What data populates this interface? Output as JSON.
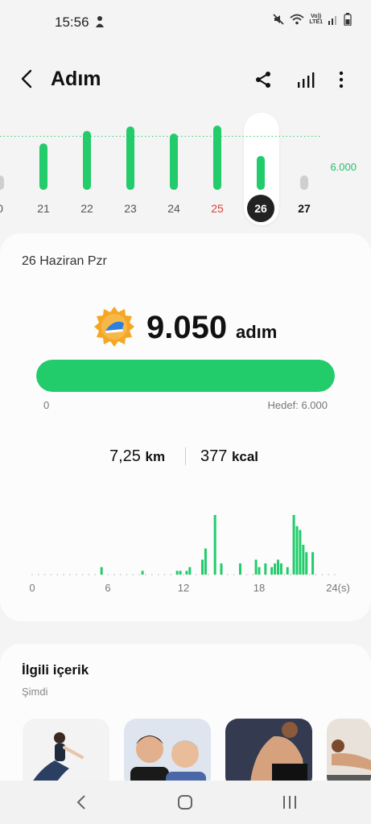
{
  "status": {
    "time": "15:56",
    "lte_top": "Vo))",
    "lte_bottom": "LTE1",
    "icons": [
      "person-icon",
      "mute-icon",
      "wifi-icon",
      "signal-icon",
      "battery-icon"
    ]
  },
  "header": {
    "title": "Adım",
    "icons": [
      "back-arrow-icon",
      "share-icon",
      "bar-chart-icon",
      "more-vertical-icon"
    ]
  },
  "week": {
    "goal": 6000,
    "goal_label": "6.000",
    "days": [
      {
        "label": "0",
        "value": 400,
        "color": "#555555"
      },
      {
        "label": "21",
        "value": 5200,
        "color": "#555555"
      },
      {
        "label": "22",
        "value": 6600,
        "color": "#555555"
      },
      {
        "label": "23",
        "value": 7100,
        "color": "#555555"
      },
      {
        "label": "24",
        "value": 6300,
        "color": "#555555"
      },
      {
        "label": "25",
        "value": 7200,
        "color": "#d94040"
      },
      {
        "label": "26",
        "value": 3800,
        "color": "#ffffff",
        "selected": true
      },
      {
        "label": "27",
        "value": 400,
        "color": "#111111"
      }
    ],
    "bar_color": "#22cc6b",
    "empty_color": "#cfcfcf"
  },
  "summary": {
    "date": "26 Haziran Pzr",
    "steps": "9.050",
    "unit": "adım",
    "progress_fraction": 1.0,
    "min_label": "0",
    "goal_label": "Hedef: 6.000",
    "distance_value": "7,25",
    "distance_unit": "km",
    "calories_value": "377",
    "calories_unit": "kcal"
  },
  "chart_data": {
    "type": "bar",
    "x_tick_labels": [
      "0",
      "6",
      "12",
      "18",
      "24(s)"
    ],
    "x_ticks": [
      0,
      6,
      12,
      18,
      24
    ],
    "xlim": [
      0,
      24
    ],
    "bar_width_hours": 0.25,
    "x": [
      5.5,
      8.75,
      11.25,
      11.5,
      11.75,
      12.0,
      12.25,
      12.5,
      13.25,
      13.5,
      13.75,
      14.0,
      14.5,
      15.0,
      15.5,
      16.0,
      16.5,
      17.0,
      17.5,
      17.75,
      18.0,
      18.5,
      18.75,
      19.0,
      19.25,
      19.5,
      19.75,
      20.25,
      20.75,
      21.0,
      21.25,
      21.5,
      21.75,
      22.25
    ],
    "y": [
      2,
      1,
      0,
      1,
      1,
      0,
      1,
      2,
      0,
      4,
      7,
      0,
      16,
      3,
      0,
      0,
      3,
      0,
      0,
      4,
      2,
      3,
      0,
      2,
      3,
      4,
      3,
      2,
      16,
      13,
      12,
      8,
      6,
      6
    ],
    "bar_color": "#22cc6b"
  },
  "related": {
    "title": "İlgili içerik",
    "subtitle": "Şimdi"
  },
  "navbar": {
    "icons": [
      "nav-back-icon",
      "nav-home-icon",
      "nav-recents-icon"
    ]
  }
}
